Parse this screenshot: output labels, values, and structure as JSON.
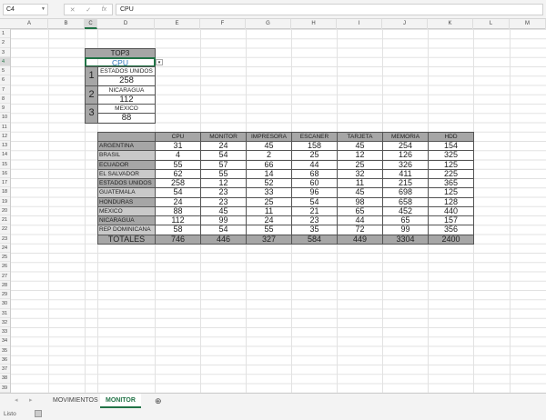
{
  "formula_bar": {
    "name_box": "C4",
    "fx": "fx",
    "content": "CPU"
  },
  "columns": [
    "A",
    "B",
    "C",
    "D",
    "E",
    "F",
    "G",
    "H",
    "I",
    "J",
    "K",
    "L",
    "M"
  ],
  "top3": {
    "title": "TOP3",
    "selected": "CPU",
    "ranks": [
      {
        "rank": "1",
        "country": "ESTADOS UNIDOS",
        "value": "258"
      },
      {
        "rank": "2",
        "country": "NICARAGUA",
        "value": "112"
      },
      {
        "rank": "3",
        "country": "MEXICO",
        "value": "88"
      }
    ]
  },
  "table": {
    "headers": [
      "CPU",
      "MONITOR",
      "IMPRESORA",
      "ESCANER",
      "TARJETA",
      "MEMORIA",
      "HDD"
    ],
    "rows": [
      {
        "country": "ARGENTINA",
        "values": [
          "31",
          "24",
          "45",
          "158",
          "45",
          "254",
          "154"
        ]
      },
      {
        "country": "BRASIL",
        "values": [
          "4",
          "54",
          "2",
          "25",
          "12",
          "126",
          "325"
        ]
      },
      {
        "country": "ECUADOR",
        "values": [
          "55",
          "57",
          "66",
          "44",
          "25",
          "326",
          "125"
        ]
      },
      {
        "country": "EL SALVADOR",
        "values": [
          "62",
          "55",
          "14",
          "68",
          "32",
          "411",
          "225"
        ]
      },
      {
        "country": "ESTADOS UNIDOS",
        "values": [
          "258",
          "12",
          "52",
          "60",
          "11",
          "215",
          "365"
        ]
      },
      {
        "country": "GUATEMALA",
        "values": [
          "54",
          "23",
          "33",
          "96",
          "45",
          "698",
          "125"
        ]
      },
      {
        "country": "HONDURAS",
        "values": [
          "24",
          "23",
          "25",
          "54",
          "98",
          "658",
          "128"
        ]
      },
      {
        "country": "MEXICO",
        "values": [
          "88",
          "45",
          "11",
          "21",
          "65",
          "452",
          "440"
        ]
      },
      {
        "country": "NICARAGUA",
        "values": [
          "112",
          "99",
          "24",
          "23",
          "44",
          "65",
          "157"
        ]
      },
      {
        "country": "REP DOMINICANA",
        "values": [
          "58",
          "54",
          "55",
          "35",
          "72",
          "99",
          "356"
        ]
      }
    ],
    "totals_label": "TOTALES",
    "totals": [
      "746",
      "446",
      "327",
      "584",
      "449",
      "3304",
      "2400"
    ]
  },
  "sheets": [
    {
      "name": "MOVIMIENTOS",
      "active": false
    },
    {
      "name": "MONITOR",
      "active": true
    }
  ],
  "status": "Listo",
  "colors": {
    "header_gray": "#a6a6a6",
    "light_gray": "#c9c9c9",
    "accent": "#217346",
    "cpu_text": "#2e75b6"
  }
}
